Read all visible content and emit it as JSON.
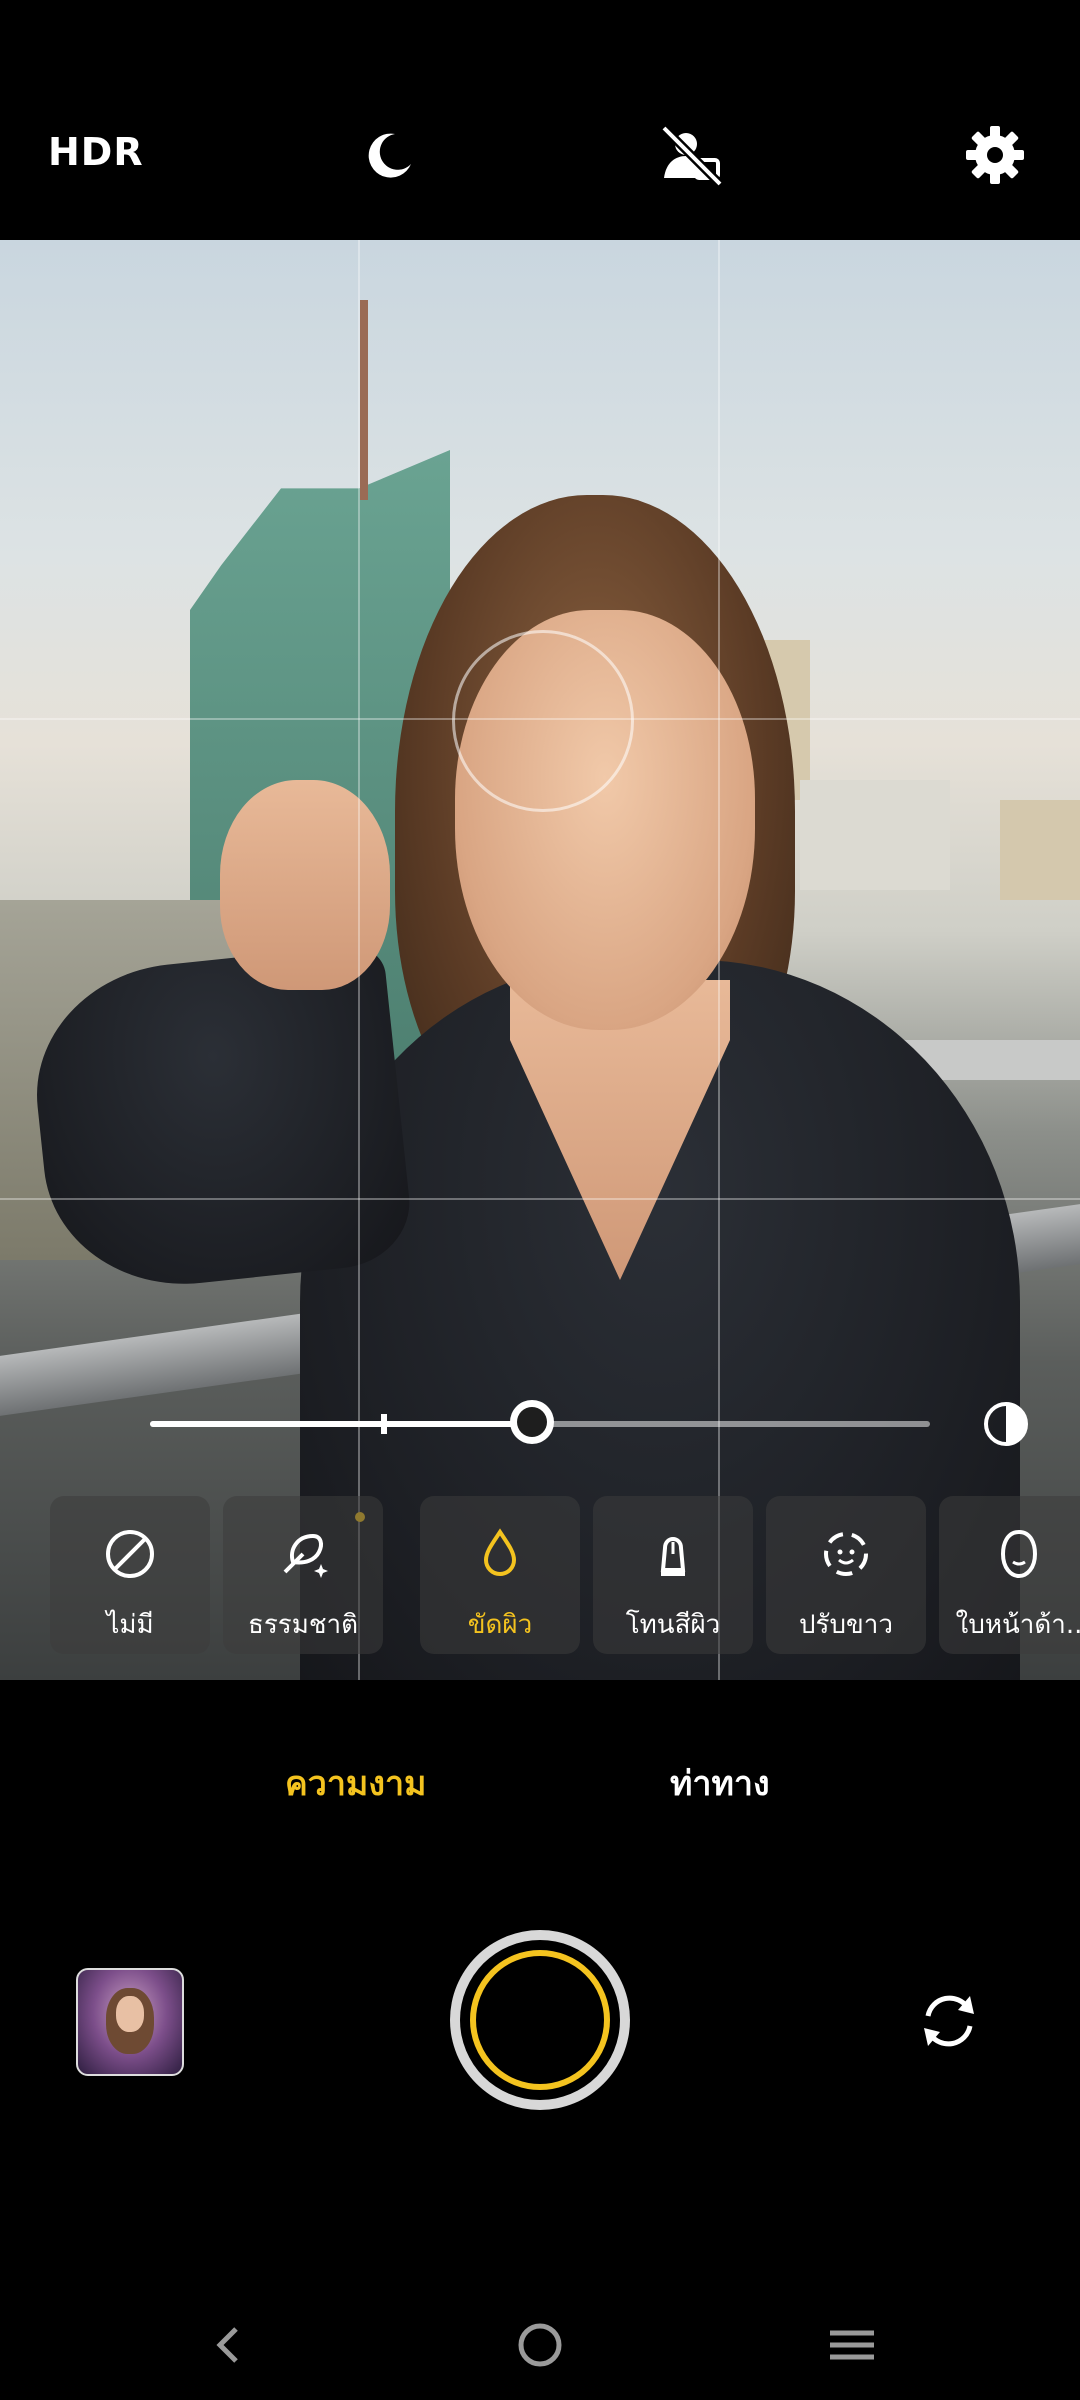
{
  "top_bar": {
    "hdr_label": "HDR",
    "icons": [
      "moon-icon",
      "no-face-detect-icon",
      "gear-icon"
    ]
  },
  "slider": {
    "value_fraction": 0.49
  },
  "beauty_options": [
    {
      "label": "ไม่มี",
      "icon": "none-icon"
    },
    {
      "label": "ธรรมชาติ",
      "icon": "natural-icon"
    },
    {
      "label": "ขัดผิว",
      "icon": "smooth-skin-icon",
      "active": true
    },
    {
      "label": "โทนสีผิว",
      "icon": "skin-tone-icon"
    },
    {
      "label": "ปรับขาว",
      "icon": "whiten-icon"
    },
    {
      "label": "ใบหน้าด้า..",
      "icon": "face-shape-icon"
    }
  ],
  "modes": {
    "beauty": "ความงาม",
    "pose": "ท่าทาง"
  },
  "colors": {
    "accent": "#f4c31f"
  }
}
